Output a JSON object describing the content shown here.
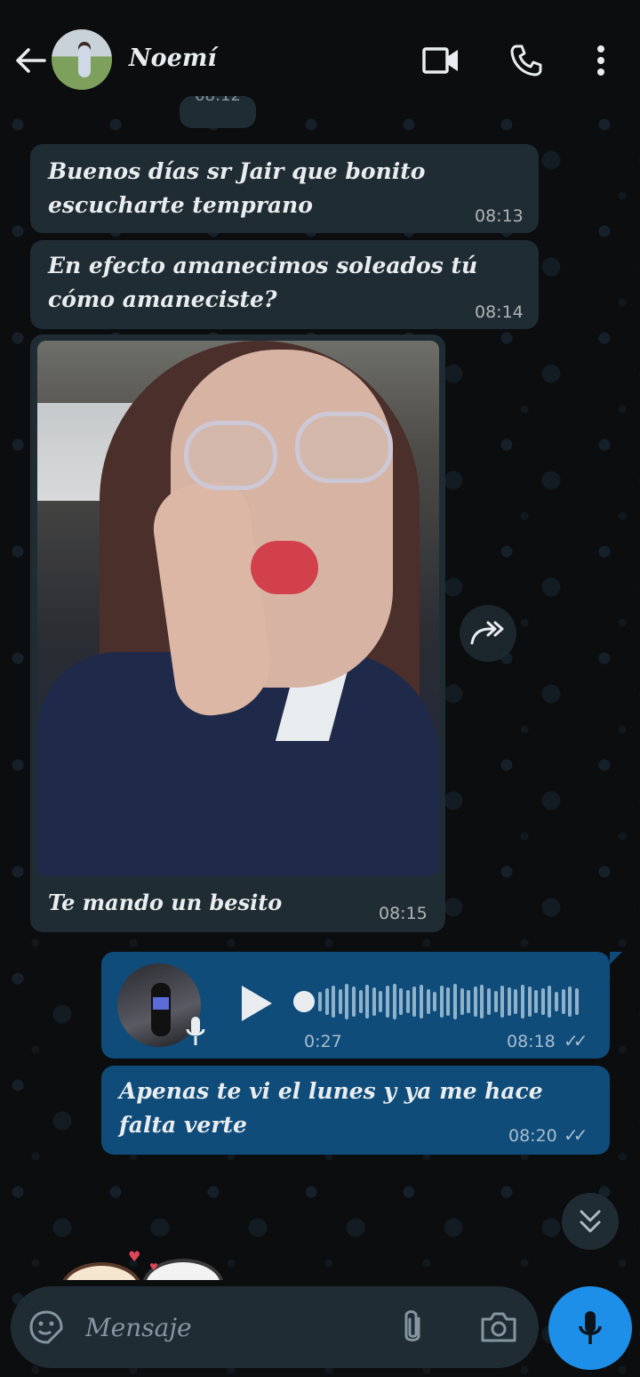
{
  "header": {
    "contact_name": "Noemí",
    "icons": [
      "back-arrow-icon",
      "video-call-icon",
      "phone-icon",
      "more-vert-icon"
    ]
  },
  "date_pill": "08:12",
  "messages": [
    {
      "direction": "in",
      "lines": [
        "Buenos días sr Jair que bonito",
        "escucharte temprano"
      ],
      "time": "08:13"
    },
    {
      "direction": "in",
      "lines": [
        "En efecto amanecimos soleados tú",
        "cómo amaneciste?"
      ],
      "time": "08:14"
    },
    {
      "direction": "in",
      "type": "image",
      "caption": "Te mando un besito",
      "time": "08:15"
    },
    {
      "direction": "out",
      "type": "voice",
      "duration": "0:27",
      "time": "08:18",
      "status": "read"
    },
    {
      "direction": "out",
      "lines": [
        "Apenas te vi el lunes y ya me hace",
        "falta verte"
      ],
      "time": "08:20",
      "status": "read"
    }
  ],
  "composer": {
    "placeholder": "Mensaje"
  },
  "colors": {
    "incoming_bubble": "#202c33",
    "outgoing_bubble": "#0f4c7a",
    "mic_button": "#1d8fe8",
    "background": "#0b0d0f"
  }
}
